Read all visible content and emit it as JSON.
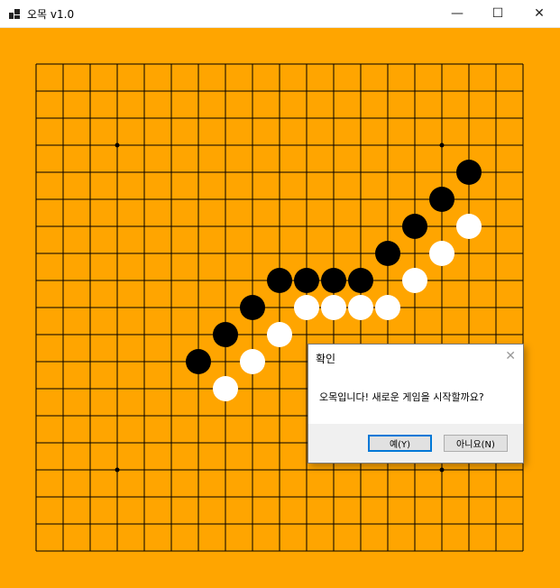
{
  "window": {
    "title": "오목 v1.0",
    "icons": {
      "app": "app-icon",
      "minimize": "minimize-icon",
      "maximize": "maximize-icon",
      "close": "close-icon"
    },
    "minimize_glyph": "—",
    "maximize_glyph": "☐",
    "close_glyph": "✕"
  },
  "board": {
    "size": 19,
    "background": "#FFA500",
    "line_color": "#000000",
    "star_points": [
      [
        3,
        3
      ],
      [
        15,
        3
      ],
      [
        3,
        15
      ],
      [
        15,
        15
      ]
    ],
    "black_stones": [
      [
        16,
        4
      ],
      [
        15,
        5
      ],
      [
        14,
        6
      ],
      [
        13,
        7
      ],
      [
        12,
        8
      ],
      [
        11,
        8
      ],
      [
        10,
        8
      ],
      [
        9,
        8
      ],
      [
        8,
        9
      ],
      [
        7,
        10
      ],
      [
        6,
        11
      ]
    ],
    "white_stones": [
      [
        16,
        6
      ],
      [
        15,
        7
      ],
      [
        14,
        8
      ],
      [
        13,
        9
      ],
      [
        12,
        9
      ],
      [
        11,
        9
      ],
      [
        10,
        9
      ],
      [
        9,
        10
      ],
      [
        8,
        11
      ],
      [
        7,
        12
      ]
    ]
  },
  "dialog": {
    "title": "확인",
    "close_glyph": "✕",
    "message": "오목입니다! 새로운 게임을 시작할까요?",
    "yes_label": "예(Y)",
    "no_label": "아니요(N)"
  }
}
